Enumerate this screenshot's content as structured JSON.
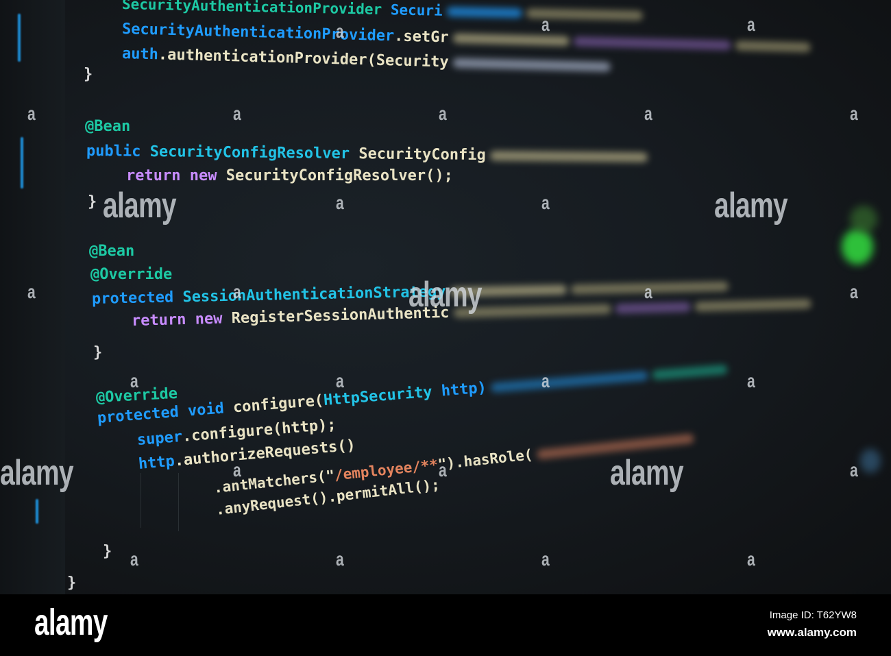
{
  "colors": {
    "annotation": "#1dc9a4",
    "keyword": "#1f9cff",
    "type": "#22c3e6",
    "plain": "#e9e3c4",
    "return": "#c88cff",
    "string": "#e4845e",
    "brace": "#d8d8d8"
  },
  "code_lines": [
    {
      "tokens": [
        {
          "t": "SecurityAuthenticationProvider",
          "c": "annotation"
        },
        {
          "t": " Securi",
          "c": "keyword"
        }
      ],
      "blur_tail": [
        "#1f9cff",
        "#9a946e"
      ]
    },
    {
      "tokens": [
        {
          "t": "SecurityAuthenticationProvider",
          "c": "keyword"
        },
        {
          "t": ".setGr",
          "c": "plain"
        }
      ],
      "blur_tail": [
        "#bdb58a",
        "#7a5aa0",
        "#9a946e"
      ]
    },
    {
      "tokens": [
        {
          "t": "auth",
          "c": "keyword"
        },
        {
          "t": ".authenticationProvider(",
          "c": "plain"
        },
        {
          "t": "Security",
          "c": "plain"
        }
      ],
      "blur_tail": [
        "#a9b4cc"
      ]
    },
    {
      "tokens": [
        {
          "t": "}",
          "c": "brace"
        }
      ],
      "blur_tail": []
    },
    {
      "tokens": [
        {
          "t": "@Bean",
          "c": "annotation"
        }
      ],
      "blur_tail": []
    },
    {
      "tokens": [
        {
          "t": "public",
          "c": "keyword"
        },
        {
          "t": " SecurityConfigResolver",
          "c": "type"
        },
        {
          "t": " SecurityConfig",
          "c": "plain"
        }
      ],
      "blur_tail": [
        "#bdb58a"
      ]
    },
    {
      "tokens": [
        {
          "t": "return",
          "c": "return"
        },
        {
          "t": " new",
          "c": "return"
        },
        {
          "t": " SecurityConfigResolver();",
          "c": "plain"
        }
      ],
      "blur_tail": []
    },
    {
      "tokens": [
        {
          "t": "}",
          "c": "brace"
        }
      ],
      "blur_tail": []
    },
    {
      "tokens": [
        {
          "t": "@Bean",
          "c": "annotation"
        }
      ],
      "blur_tail": []
    },
    {
      "tokens": [
        {
          "t": "@Override",
          "c": "annotation"
        }
      ],
      "blur_tail": []
    },
    {
      "tokens": [
        {
          "t": "protected",
          "c": "keyword"
        },
        {
          "t": " SessionAuthenticationStrategy",
          "c": "type"
        }
      ],
      "blur_tail": [
        "#bdb58a",
        "#9a946e"
      ]
    },
    {
      "tokens": [
        {
          "t": "return",
          "c": "return"
        },
        {
          "t": " new",
          "c": "return"
        },
        {
          "t": " RegisterSessionAuthentic",
          "c": "plain"
        }
      ],
      "blur_tail": [
        "#9a946e",
        "#7a5aa0",
        "#9a946e"
      ]
    },
    {
      "tokens": [
        {
          "t": "}",
          "c": "brace"
        }
      ],
      "blur_tail": []
    },
    {
      "tokens": [
        {
          "t": "@Override",
          "c": "annotation"
        }
      ],
      "blur_tail": []
    },
    {
      "tokens": [
        {
          "t": "protected",
          "c": "keyword"
        },
        {
          "t": " void",
          "c": "keyword"
        },
        {
          "t": " configure(",
          "c": "plain"
        },
        {
          "t": "HttpSecurity",
          "c": "type"
        },
        {
          "t": " http)",
          "c": "keyword"
        }
      ],
      "blur_tail": [
        "#1f7cc0",
        "#1a9a80"
      ]
    },
    {
      "tokens": [
        {
          "t": "super",
          "c": "keyword"
        },
        {
          "t": ".configure(http);",
          "c": "plain"
        }
      ],
      "blur_tail": []
    },
    {
      "tokens": [
        {
          "t": "http",
          "c": "keyword"
        },
        {
          "t": ".authorizeRequests()",
          "c": "plain"
        }
      ],
      "blur_tail": []
    },
    {
      "tokens": [
        {
          "t": ".antMatchers(\"",
          "c": "plain"
        },
        {
          "t": "/employee/**",
          "c": "string"
        },
        {
          "t": "\").hasRole(",
          "c": "plain"
        }
      ],
      "blur_tail": [
        "#b06a50"
      ]
    },
    {
      "tokens": [
        {
          "t": ".anyRequest().permitAll();",
          "c": "plain"
        }
      ],
      "blur_tail": []
    },
    {
      "tokens": [
        {
          "t": "}",
          "c": "brace"
        }
      ],
      "blur_tail": []
    },
    {
      "tokens": [
        {
          "t": "}",
          "c": "brace"
        }
      ],
      "blur_tail": []
    }
  ],
  "watermark": {
    "word": "alamy",
    "letter": "a"
  },
  "footer": {
    "logo": "alamy",
    "image_id": "Image ID: T62YW8",
    "url": "www.alamy.com"
  }
}
